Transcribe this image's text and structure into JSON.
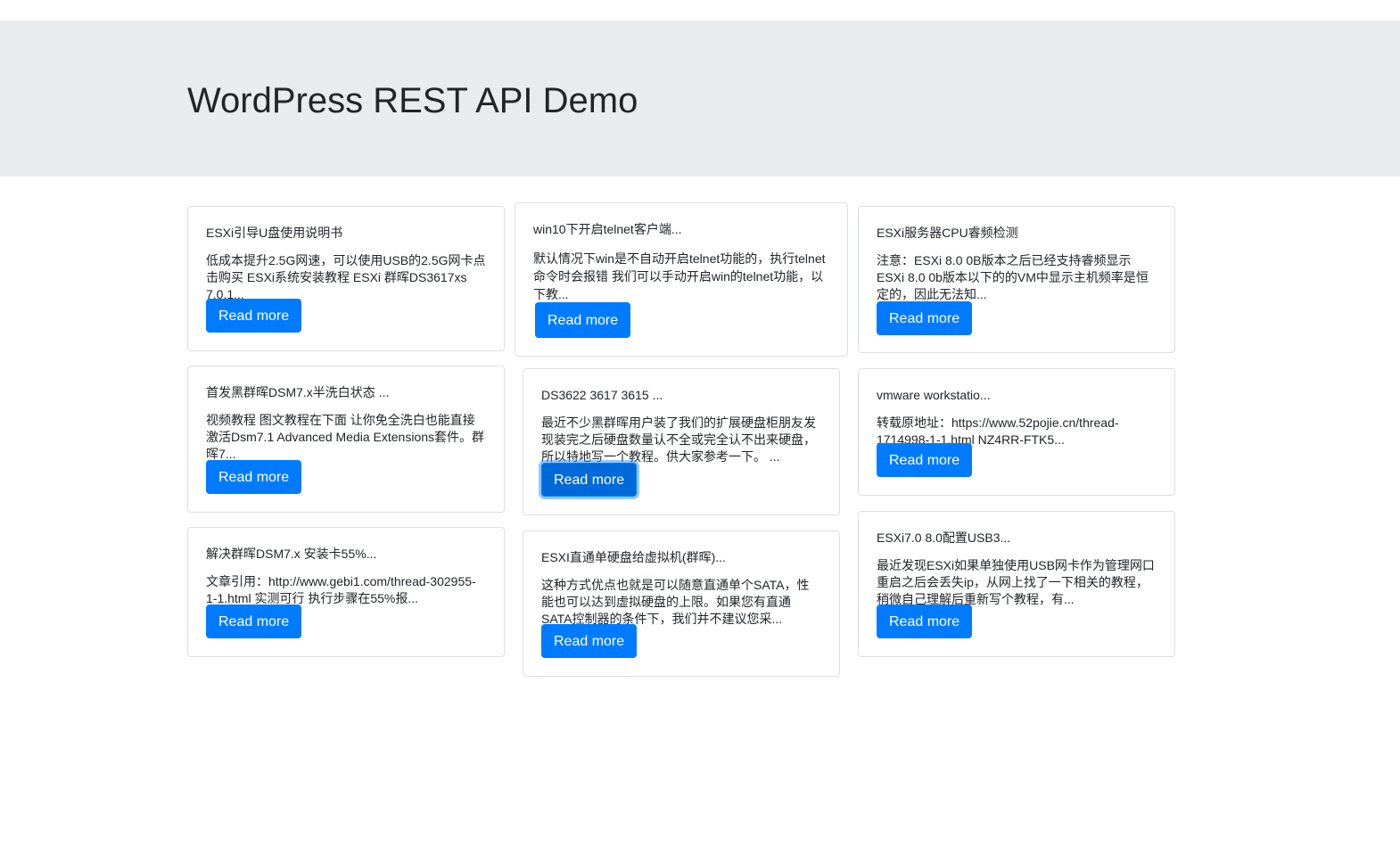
{
  "header": {
    "title": "WordPress REST API Demo"
  },
  "posts": [
    {
      "title": "ESXi引导U盘使用说明书",
      "excerpt": "低成本提升2.5G网速，可以使用USB的2.5G网卡点击购买 ESXi系统安装教程 ESXi 群晖DS3617xs 7.0.1...",
      "button": "Read more"
    },
    {
      "title": "win10下开启telnet客户端...",
      "excerpt": "默认情况下win是不自动开启telnet功能的，执行telnet命令时会报错 我们可以手动开启win的telnet功能，以下教...",
      "button": "Read more"
    },
    {
      "title": "ESXi服务器CPU睿频检测",
      "excerpt": "注意：ESXi 8.0 0B版本之后已经支持睿频显示 ESXi 8.0 0b版本以下的的VM中显示主机频率是恒定的，因此无法知...",
      "button": "Read more"
    },
    {
      "title": "首发黑群晖DSM7.x半洗白状态 ...",
      "excerpt": "视频教程 图文教程在下面 让你免全洗白也能直接激活Dsm7.1 Advanced Media Extensions套件。群晖7...",
      "button": "Read more"
    },
    {
      "title": "DS3622 3617 3615 ...",
      "excerpt": "最近不少黑群晖用户装了我们的扩展硬盘柜朋友发现装完之后硬盘数量认不全或完全认不出来硬盘，所以特地写一个教程。供大家参考一下。 ...",
      "button": "Read more"
    },
    {
      "title": "vmware workstatio...",
      "excerpt": "转载原地址：https://www.52pojie.cn/thread-1714998-1-1.html NZ4RR-FTK5...",
      "button": "Read more"
    },
    {
      "title": "解决群晖DSM7.x 安装卡55%...",
      "excerpt": "文章引用：http://www.gebi1.com/thread-302955-1-1.html 实测可行 执行步骤在55%报...",
      "button": "Read more"
    },
    {
      "title": "ESXI直通单硬盘给虚拟机(群晖)...",
      "excerpt": "这种方式优点也就是可以随意直通单个SATA，性能也可以达到虚拟硬盘的上限。如果您有直通SATA控制器的条件下，我们并不建议您采...",
      "button": "Read more"
    },
    {
      "title": "ESXi7.0 8.0配置USB3...",
      "excerpt": "最近发现ESXi如果单独使用USB网卡作为管理网口重启之后会丢失ip，从网上找了一下相关的教程，稍微自己理解后重新写个教程，有...",
      "button": "Read more"
    }
  ]
}
